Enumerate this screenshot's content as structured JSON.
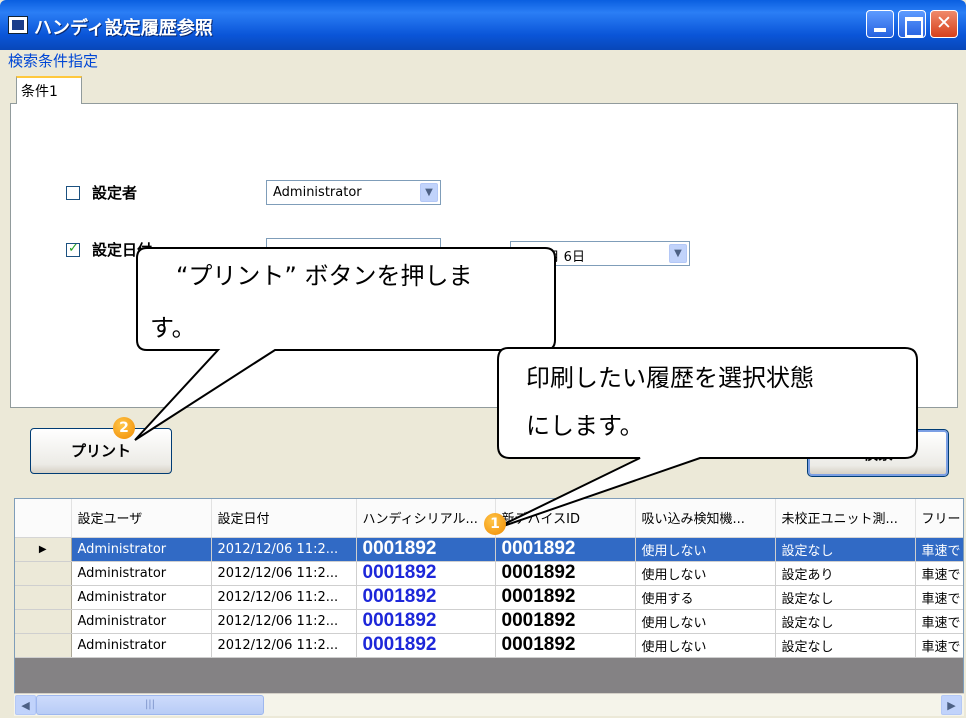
{
  "window": {
    "title": "ハンディ設定履歴参照"
  },
  "search": {
    "group_label": "検索条件指定",
    "tab_label": "条件1",
    "setter": {
      "label": "設定者",
      "checked": false,
      "value": "Administrator"
    },
    "date": {
      "label": "設定日付",
      "checked": true,
      "to_value": "年12月 6日"
    }
  },
  "buttons": {
    "print": "プリント",
    "search": "検索"
  },
  "grid": {
    "columns": [
      "設定ユーザ",
      "設定日付",
      "ハンディシリアル...",
      "新デバイスID",
      "吸い込み検知機...",
      "未校正ユニット測...",
      "フリー"
    ],
    "rows": [
      [
        "Administrator",
        "2012/12/06 11:2...",
        "0001892",
        "0001892",
        "使用しない",
        "設定なし",
        "車速で"
      ],
      [
        "Administrator",
        "2012/12/06 11:2...",
        "0001892",
        "0001892",
        "使用しない",
        "設定あり",
        "車速で"
      ],
      [
        "Administrator",
        "2012/12/06 11:2...",
        "0001892",
        "0001892",
        "使用する",
        "設定なし",
        "車速で"
      ],
      [
        "Administrator",
        "2012/12/06 11:2...",
        "0001892",
        "0001892",
        "使用しない",
        "設定なし",
        "車速で"
      ],
      [
        "Administrator",
        "2012/12/06 11:2...",
        "0001892",
        "0001892",
        "使用しない",
        "設定なし",
        "車速で"
      ]
    ],
    "selected_row": 0
  },
  "callouts": {
    "print_line1": "“プリント” ボタンを押しま",
    "print_line2": "す。",
    "select_line1": "印刷したい履歴を選択状態",
    "select_line2": "にします。",
    "marker1": "1",
    "marker2": "2"
  }
}
